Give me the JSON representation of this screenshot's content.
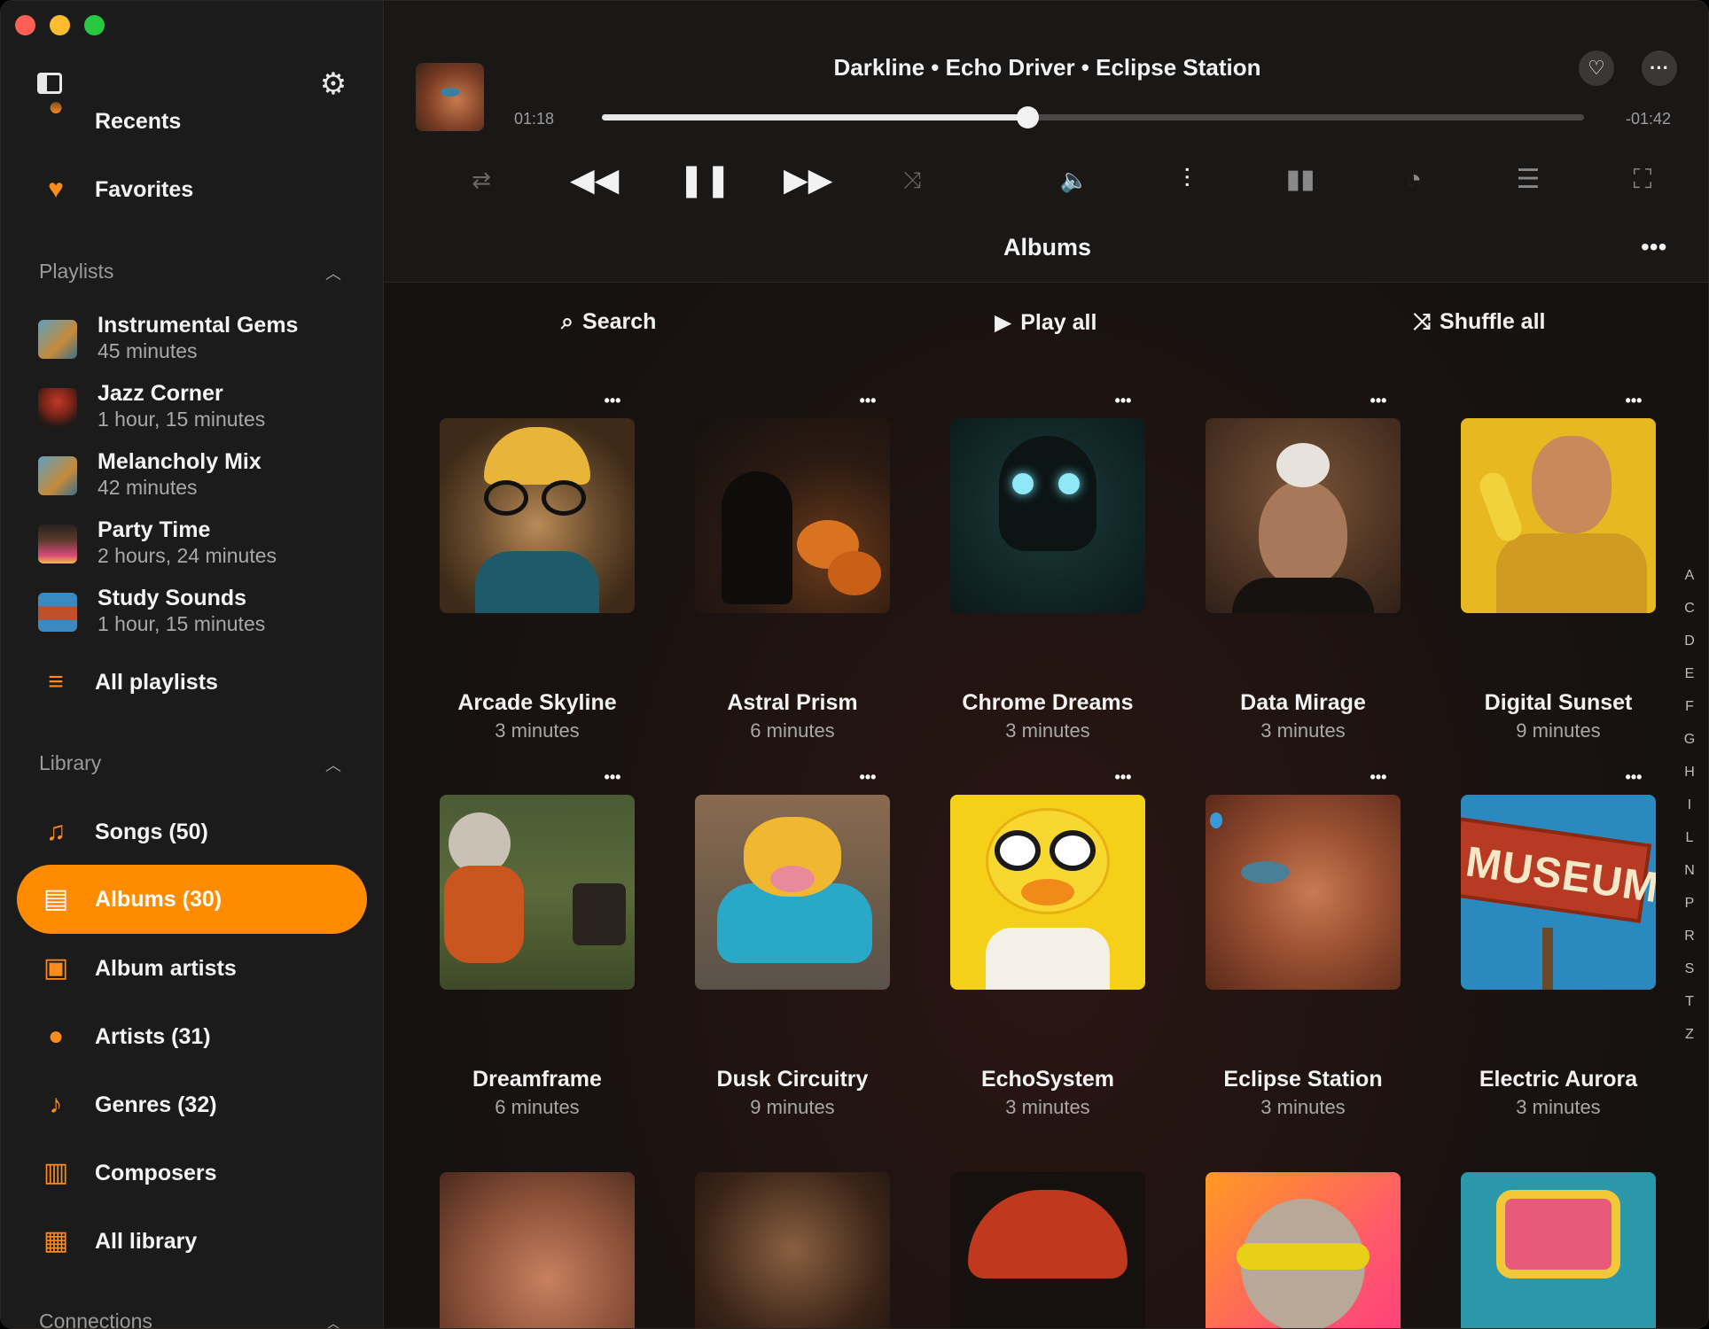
{
  "sidebar": {
    "items_top": [
      {
        "label": "Recents",
        "icon": "clock-icon"
      },
      {
        "label": "Favorites",
        "icon": "heart-icon"
      }
    ],
    "playlists_header": "Playlists",
    "playlists": [
      {
        "name": "Instrumental Gems",
        "duration": "45 minutes"
      },
      {
        "name": "Jazz Corner",
        "duration": "1 hour, 15 minutes"
      },
      {
        "name": "Melancholy Mix",
        "duration": "42 minutes"
      },
      {
        "name": "Party Time",
        "duration": "2 hours, 24 minutes"
      },
      {
        "name": "Study Sounds",
        "duration": "1 hour, 15 minutes"
      }
    ],
    "all_playlists": "All playlists",
    "library_header": "Library",
    "library": [
      {
        "label": "Songs (50)",
        "icon": "music-note-icon"
      },
      {
        "label": "Albums (30)",
        "icon": "albums-icon"
      },
      {
        "label": "Album artists",
        "icon": "album-artists-icon"
      },
      {
        "label": "Artists (31)",
        "icon": "person-icon"
      },
      {
        "label": "Genres (32)",
        "icon": "genres-icon"
      },
      {
        "label": "Composers",
        "icon": "piano-icon"
      },
      {
        "label": "All library",
        "icon": "library-icon"
      }
    ],
    "connections_header": "Connections",
    "accent": "#ff8c00"
  },
  "player": {
    "title": "Darkline • Echo Driver • Eclipse Station",
    "elapsed": "01:18",
    "remaining": "-01:42",
    "progress": 0.433
  },
  "main": {
    "title": "Albums",
    "search": "Search",
    "play_all": "Play all",
    "shuffle_all": "Shuffle all"
  },
  "albums": [
    {
      "name": "Arcade Skyline",
      "duration": "3 minutes"
    },
    {
      "name": "Astral Prism",
      "duration": "6 minutes"
    },
    {
      "name": "Chrome Dreams",
      "duration": "3 minutes"
    },
    {
      "name": "Data Mirage",
      "duration": "3 minutes"
    },
    {
      "name": "Digital Sunset",
      "duration": "9 minutes"
    },
    {
      "name": "Dreamframe",
      "duration": "6 minutes"
    },
    {
      "name": "Dusk Circuitry",
      "duration": "9 minutes"
    },
    {
      "name": "EchoSystem",
      "duration": "3 minutes"
    },
    {
      "name": "Eclipse Station",
      "duration": "3 minutes"
    },
    {
      "name": "Electric Aurora",
      "duration": "3 minutes"
    }
  ],
  "az_index": [
    "A",
    "C",
    "D",
    "E",
    "F",
    "G",
    "H",
    "I",
    "L",
    "N",
    "P",
    "R",
    "S",
    "T",
    "Z"
  ]
}
